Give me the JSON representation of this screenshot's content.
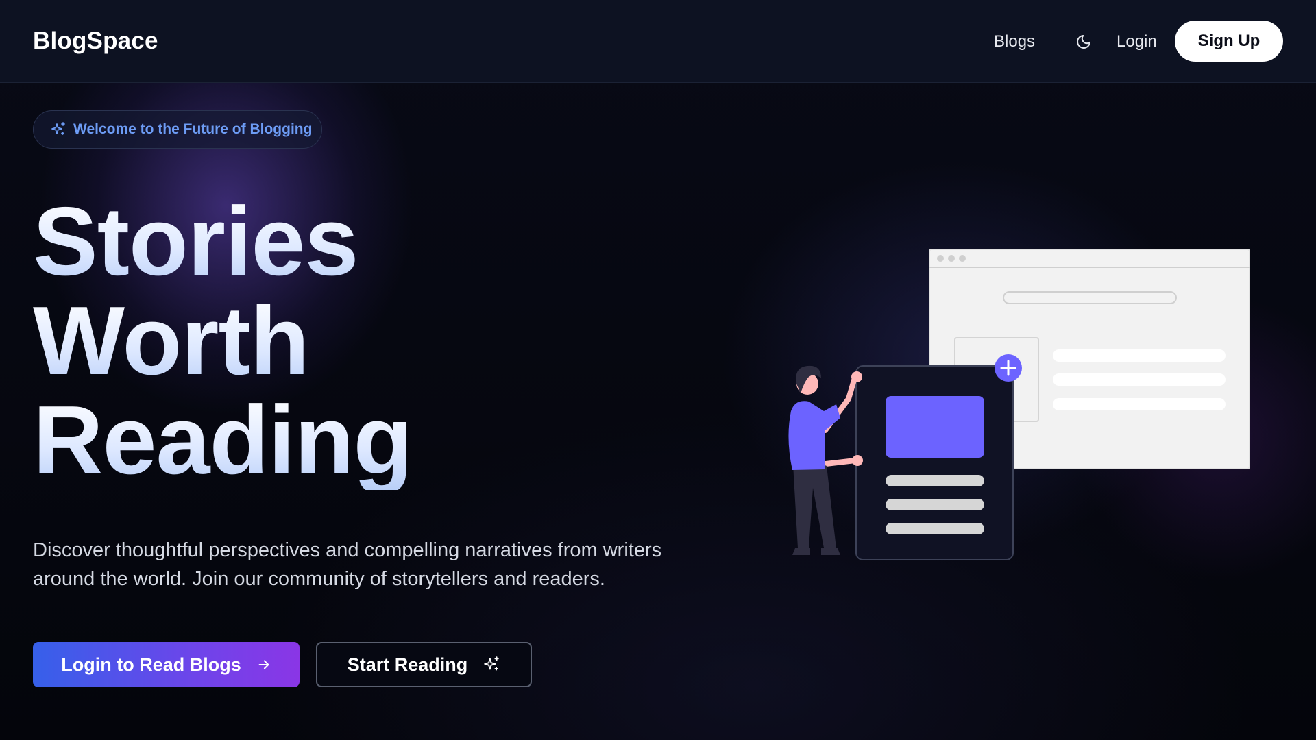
{
  "navbar": {
    "brand": "BlogSpace",
    "links": {
      "blogs": "Blogs",
      "login": "Login"
    },
    "signup_label": "Sign Up",
    "theme_toggle_icon": "moon-icon"
  },
  "hero": {
    "badge_text": "Welcome to the Future of Blogging",
    "badge_icon": "sparkles-icon",
    "headline": [
      "Stories",
      "Worth",
      "Reading"
    ],
    "subtitle_lines": [
      "Discover thoughtful perspectives and compelling narratives from writers",
      "around the world. Join our community of storytellers and readers."
    ],
    "primary_cta": {
      "label": "Login to Read Blogs",
      "icon": "arrow-right-icon"
    },
    "secondary_cta": {
      "label": "Start Reading",
      "icon": "sparkles-icon"
    }
  },
  "colors": {
    "background": "#04050b",
    "navbar": "#0d1222",
    "badge_text": "#6d9cf5",
    "primary_gradient_start": "#3660ea",
    "primary_gradient_end": "#8a36e6",
    "illustration_accent": "#6c63ff"
  }
}
